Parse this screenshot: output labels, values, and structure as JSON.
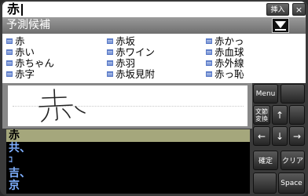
{
  "input": {
    "text": "赤"
  },
  "topbar": {
    "insert_label": "挿入",
    "close_label": "×"
  },
  "prediction": {
    "header": "予測候補",
    "items": [
      [
        "赤",
        "赤い",
        "赤ちゃん",
        "赤字"
      ],
      [
        "赤坂",
        "赤ワイン",
        "赤羽",
        "赤坂見附"
      ],
      [
        "赤かっ",
        "赤血球",
        "赤外線",
        "赤っ恥"
      ]
    ]
  },
  "candidates": [
    "赤",
    "共、",
    "ｺ",
    "吉、",
    "京"
  ],
  "keypad": {
    "menu": "Menu",
    "bunsetsu_line1": "文節",
    "bunsetsu_line2": "変換",
    "up": "↑",
    "left": "←",
    "down": "↓",
    "right": "→",
    "kakutei": "確定",
    "clear": "クリア",
    "space": "Space"
  }
}
